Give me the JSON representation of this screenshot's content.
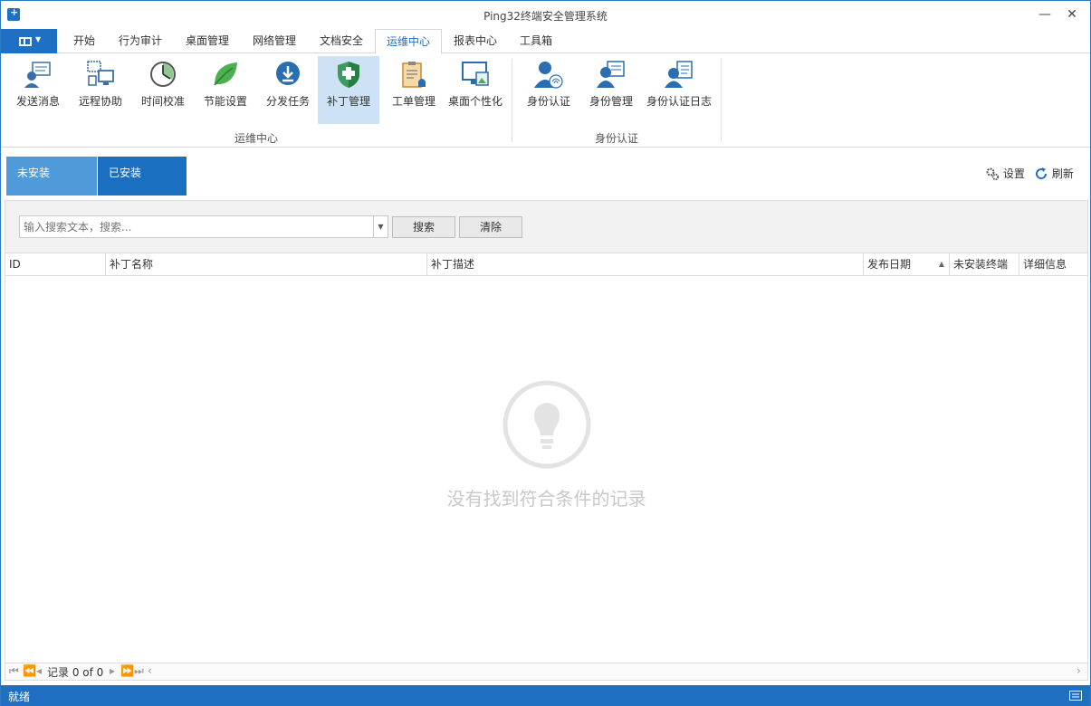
{
  "window": {
    "title": "Ping32终端安全管理系统",
    "minimize_glyph": "—",
    "close_glyph": "✕"
  },
  "menu": {
    "tabs": [
      "开始",
      "行为审计",
      "桌面管理",
      "网络管理",
      "文档安全",
      "运维中心",
      "报表中心",
      "工具箱"
    ],
    "active": "运维中心"
  },
  "ribbon": {
    "groups": [
      {
        "label": "运维中心"
      },
      {
        "label": "身份认证"
      }
    ],
    "buttons": [
      {
        "label": "发送消息",
        "icon": "send-message-icon"
      },
      {
        "label": "远程协助",
        "icon": "remote-assist-icon"
      },
      {
        "label": "时间校准",
        "icon": "clock-icon"
      },
      {
        "label": "节能设置",
        "icon": "leaf-icon"
      },
      {
        "label": "分发任务",
        "icon": "download-icon"
      },
      {
        "label": "补丁管理",
        "icon": "shield-icon",
        "selected": true
      },
      {
        "label": "工单管理",
        "icon": "clipboard-bell-icon"
      },
      {
        "label": "桌面个性化",
        "icon": "monitor-icon"
      },
      {
        "label": "身份认证",
        "icon": "fingerprint-user-icon"
      },
      {
        "label": "身份管理",
        "icon": "user-checklist-icon"
      },
      {
        "label": "身份认证日志",
        "icon": "user-log-icon"
      }
    ]
  },
  "subtabs": {
    "uninstalled": "未安装",
    "installed": "已安装",
    "active": "未安装"
  },
  "toolbar": {
    "settings_label": "设置",
    "refresh_label": "刷新"
  },
  "search": {
    "placeholder": "输入搜索文本，搜索...",
    "value": "",
    "search_label": "搜索",
    "clear_label": "清除"
  },
  "table": {
    "columns": [
      "ID",
      "补丁名称",
      "补丁描述",
      "发布日期",
      "未安装终端",
      "详细信息"
    ],
    "sorted_column": "发布日期",
    "sort_direction": "ascending",
    "rows": [],
    "empty_text": "没有找到符合条件的记录"
  },
  "pager": {
    "record_text": "记录 0 of 0"
  },
  "status": {
    "text": "就绪"
  },
  "colors": {
    "accent": "#1f6fc2",
    "tab_active": "#4f9ad8",
    "tab_inactive": "#1b6fc0",
    "ribbon_selected": "#cde3f5"
  }
}
